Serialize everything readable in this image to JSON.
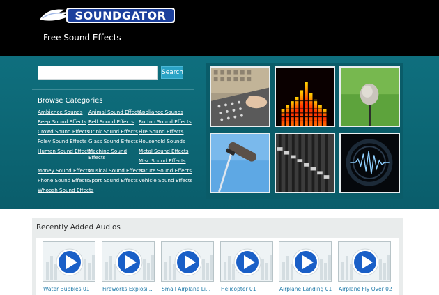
{
  "header": {
    "logo_text": "SOUNDGATOR",
    "tagline": "Free Sound Effects"
  },
  "search": {
    "value": "",
    "placeholder": "",
    "button_label": "Search"
  },
  "categories": {
    "title": "Browse Categories",
    "col1": [
      "Ambience Sounds",
      "Beep Sound Effects",
      "Crowd Sound Effects",
      "Foley Sound Effects",
      "Human Sound Effects",
      "Money Sound Effects",
      "Phone Sound Effects",
      "Whoosh Sound Effects"
    ],
    "col2": [
      "Animal Sound Effects",
      "Bell Sound Effects",
      "Drink Sound Effects",
      "Glass Sound Effects",
      "Machine Sound Effects",
      "Musical Sound Effects",
      "Sport Sound Effects"
    ],
    "col3": [
      "Appliance Sounds",
      "Button Sound Effects",
      "Fire Sound Effects",
      "Household Sounds",
      "Metal Sound Effects",
      "Misc Sound Effects",
      "Nature Sound Effects",
      "Vehicle Sound Effects"
    ]
  },
  "gallery": {
    "thumbnails": [
      "mixing-console",
      "equalizer-bars",
      "field-microphone",
      "boom-microphone",
      "fader-panel",
      "sound-wave-ring"
    ]
  },
  "recent": {
    "title": "Recently Added Audios",
    "items": [
      "Water Bubbles 01",
      "Fireworks Explosi...",
      "Small Airplane Li...",
      "Helicopter 01",
      "Airplane Landing 01",
      "Airplane Fly Over 02"
    ]
  },
  "colors": {
    "header_bg": "#000000",
    "band_teal": "#0c6674",
    "search_button": "#2aa3c5",
    "link_blue": "#1e79a8",
    "play_blue": "#1a5fc7"
  }
}
